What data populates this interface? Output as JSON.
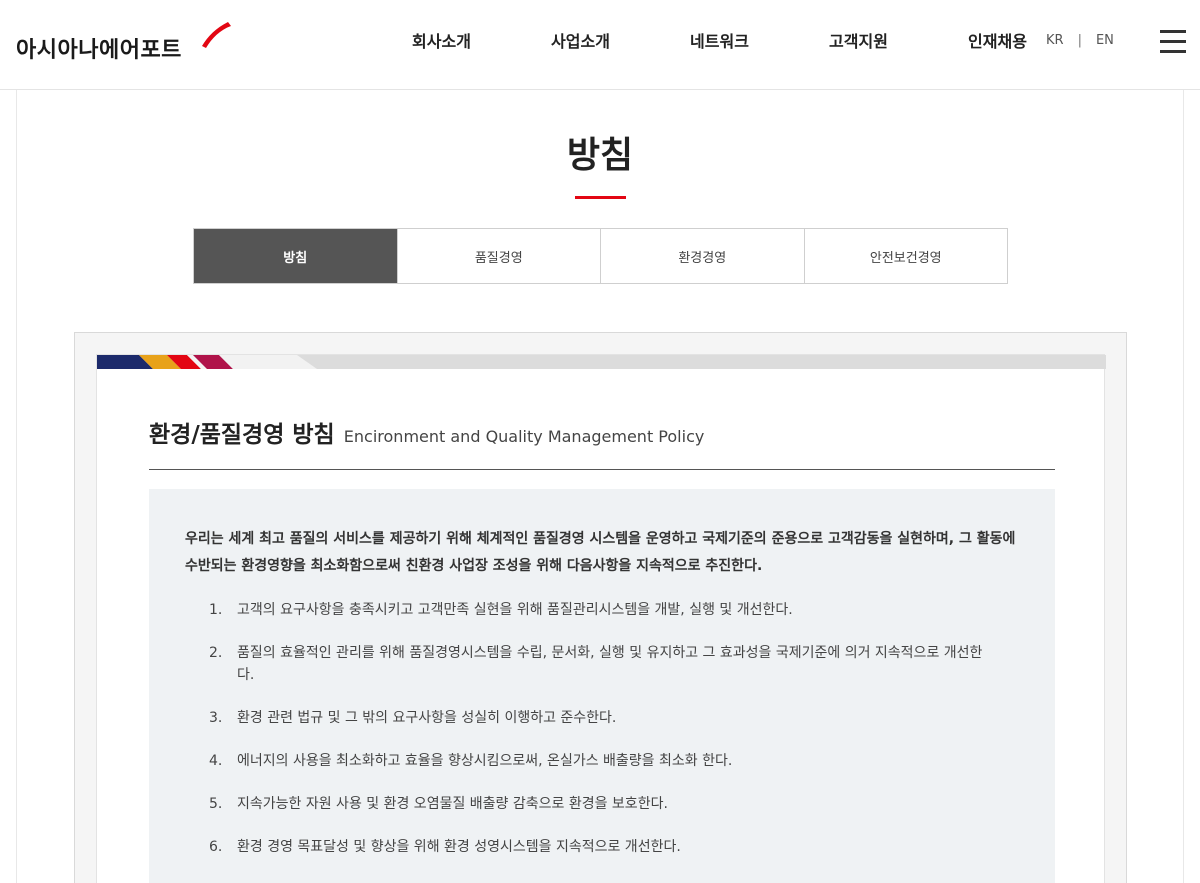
{
  "header": {
    "logo_text": "아시아나에어포트",
    "nav": [
      "회사소개",
      "사업소개",
      "네트워크",
      "고객지원",
      "인재채용"
    ],
    "lang": {
      "kr": "KR",
      "separator": "|",
      "en": "EN"
    },
    "colors": {
      "brand_red": "#e30613"
    }
  },
  "page": {
    "title": "방침",
    "tabs": [
      {
        "label": "방침",
        "active": true
      },
      {
        "label": "품질경영",
        "active": false
      },
      {
        "label": "환경경영",
        "active": false
      },
      {
        "label": "안전보건경영",
        "active": false
      }
    ]
  },
  "policy": {
    "title_ko": "환경/품질경영 방침",
    "title_en": "Encironment and Quality Management Policy",
    "intro": "우리는 세계 최고 품질의 서비스를 제공하기 위해 체계적인 품질경영 시스템을 운영하고 국제기준의 준용으로 고객감동을 실현하며, 그 활동에 수반되는 환경영향을 최소화함으로써 친환경 사업장 조성을 위해 다음사항을 지속적으로 추진한다.",
    "items": [
      {
        "num": "1.",
        "text": "고객의 요구사항을 충족시키고 고객만족 실현을 위해 품질관리시스템을 개발, 실행 및 개선한다."
      },
      {
        "num": "2.",
        "text": "품질의 효율적인 관리를 위해 품질경영시스템을 수립, 문서화, 실행 및 유지하고 그 효과성을 국제기준에 의거 지속적으로 개선한다."
      },
      {
        "num": "3.",
        "text": "환경 관련 법규 및 그 밖의 요구사항을 성실히 이행하고 준수한다."
      },
      {
        "num": "4.",
        "text": "에너지의 사용을 최소화하고 효율을 향상시킴으로써, 온실가스 배출량을 최소화 한다."
      },
      {
        "num": "5.",
        "text": "지속가능한 자원 사용 및 환경 오염물질 배출량 감축으로 환경을 보호한다."
      },
      {
        "num": "6.",
        "text": "환경 경영 목표달성 및 향상을 위해 환경 성영시스템을 지속적으로 개선한다."
      }
    ]
  }
}
